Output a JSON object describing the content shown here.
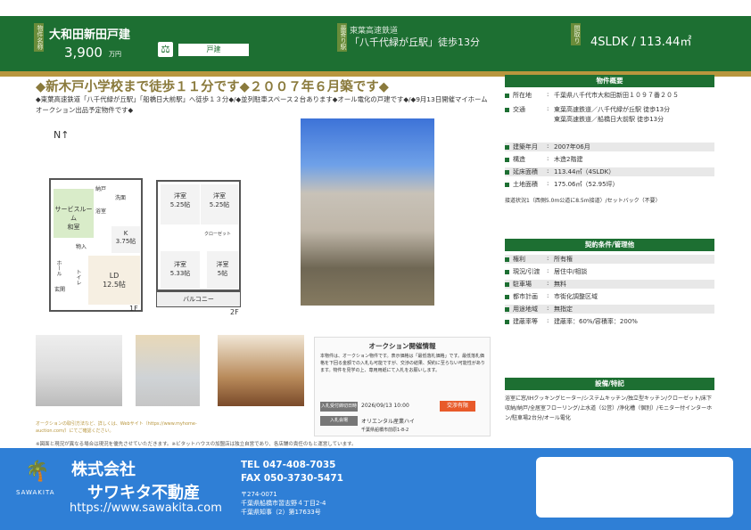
{
  "header": {
    "tag_name": "物件名称",
    "name": "大和田新田戸建",
    "price": "3,900",
    "price_unit": "万円",
    "type": "戸建",
    "tag_route": "最寄り駅",
    "rail": "東葉高速鉄道",
    "station": "「八千代緑が丘駅」徒歩13分",
    "tag_layout": "間取り",
    "layout": "4SLDK / 113.44㎡"
  },
  "headline": "◆新木戸小学校まで徒歩１１分です◆２００７年６月築です◆",
  "description": "◆東葉高速鉄道「八千代緑が丘駅」「船橋日大前駅」へ徒歩１３分◆/◆並列駐車スペース２台あります◆オール電化の戸建です◆/◆9月13日開催マイホームオークション出品予定物件です◆",
  "sidebar": {
    "overview_title": "物件概要",
    "overview": [
      {
        "label": "所在地",
        "value": "千葉県八千代市大和田新田１０９７番２０５"
      },
      {
        "label": "交通",
        "value": "東葉高速鉄道／八千代緑が丘駅 徒歩13分",
        "value2": "東葉高速鉄道／船橋日大前駅 徒歩13分"
      },
      {
        "label": "建築年月",
        "value": "2007年06月"
      },
      {
        "label": "構造",
        "value": "木造2階建"
      },
      {
        "label": "延床面積",
        "value": "113.44㎡（4SLDK）"
      },
      {
        "label": "土地面積",
        "value": "175.06㎡（52.95坪）"
      }
    ],
    "road_note": "接道状況1（西側5.0m公道に8.5m接道）/セットバック（不要）",
    "contract_title": "契約条件/管理他",
    "contract": [
      {
        "label": "権利",
        "value": "所有権"
      },
      {
        "label": "現況/引渡",
        "value": "居住中/相談"
      },
      {
        "label": "駐車場",
        "value": "無料"
      },
      {
        "label": "都市計画",
        "value": "市街化調整区域"
      },
      {
        "label": "用途地域",
        "value": "無指定"
      },
      {
        "label": "建蔽率等",
        "value": "建蔽率：60%/容積率：200%"
      }
    ],
    "facilities_title": "設備/特記",
    "facilities": "浴室に窓/IHクッキングヒーター/システムキッチン/独立型キッチン/クローゼット/床下収納/納戸/全居室フローリング/上水道（公営）/浄化槽（個別）/モニター付インターホン/駐車場2台分/オール電化"
  },
  "floorplan": {
    "rooms_1f": [
      "サービスルーム",
      "和室",
      "納戸",
      "洗面",
      "K",
      "3.75帖",
      "物入",
      "LD",
      "12.5帖",
      "ホール",
      "玄関",
      "トイレ",
      "浴室"
    ],
    "rooms_2f": [
      "洋室",
      "5.25帖",
      "洋室",
      "5.25帖",
      "洋室",
      "5.33帖",
      "洋室",
      "5帖",
      "バルコニー",
      "クローゼット"
    ],
    "label_1f": "1F",
    "label_2f": "2F"
  },
  "auction": {
    "title": "オークション開催情報",
    "body": "本物件は、オークション物件です。表示価格は「最低落札価格」です。最低落札価格を下回る金額での入札も可能ですが、交渉の結果、契約に至らない可能性があります。物件を見学の上、専用用紙にて入札をお願いします。",
    "date_label": "入札受付締切日時",
    "date_value": "2026/09/13 10:00",
    "badge": "交渉有限",
    "venue_label": "入札会場",
    "venue_value": "オリエンタル産業ハイ",
    "venue_note": "千葉県船橋市前原1-8-2"
  },
  "notes": {
    "small": "オークションの取引方法など、詳しくは、Webサイト（https://www.myhome-auction.com/）にてご確認ください。",
    "disclaimer": "※図面と現況が異なる場合は現況を優先させていただきます。※ビタットハウスの加盟店は独立自営であり、各店舗の責任のもと運営しています。"
  },
  "footer": {
    "logo_text": "SAWAKITA",
    "company_prefix": "株式会社",
    "company": "サワキタ不動産",
    "url": "https://www.sawakita.com",
    "tel": "TEL  047-408-7035",
    "fax": "FAX  050-3730-5471",
    "zip": "〒274-0071",
    "address": "千葉県船橋市習志野４丁目2-4",
    "license": "千葉県知事（2）第17633号"
  },
  "colors": {
    "brand_green": "#1d6f32",
    "gold": "#b8963e",
    "footer_blue": "#2f7fd6"
  }
}
